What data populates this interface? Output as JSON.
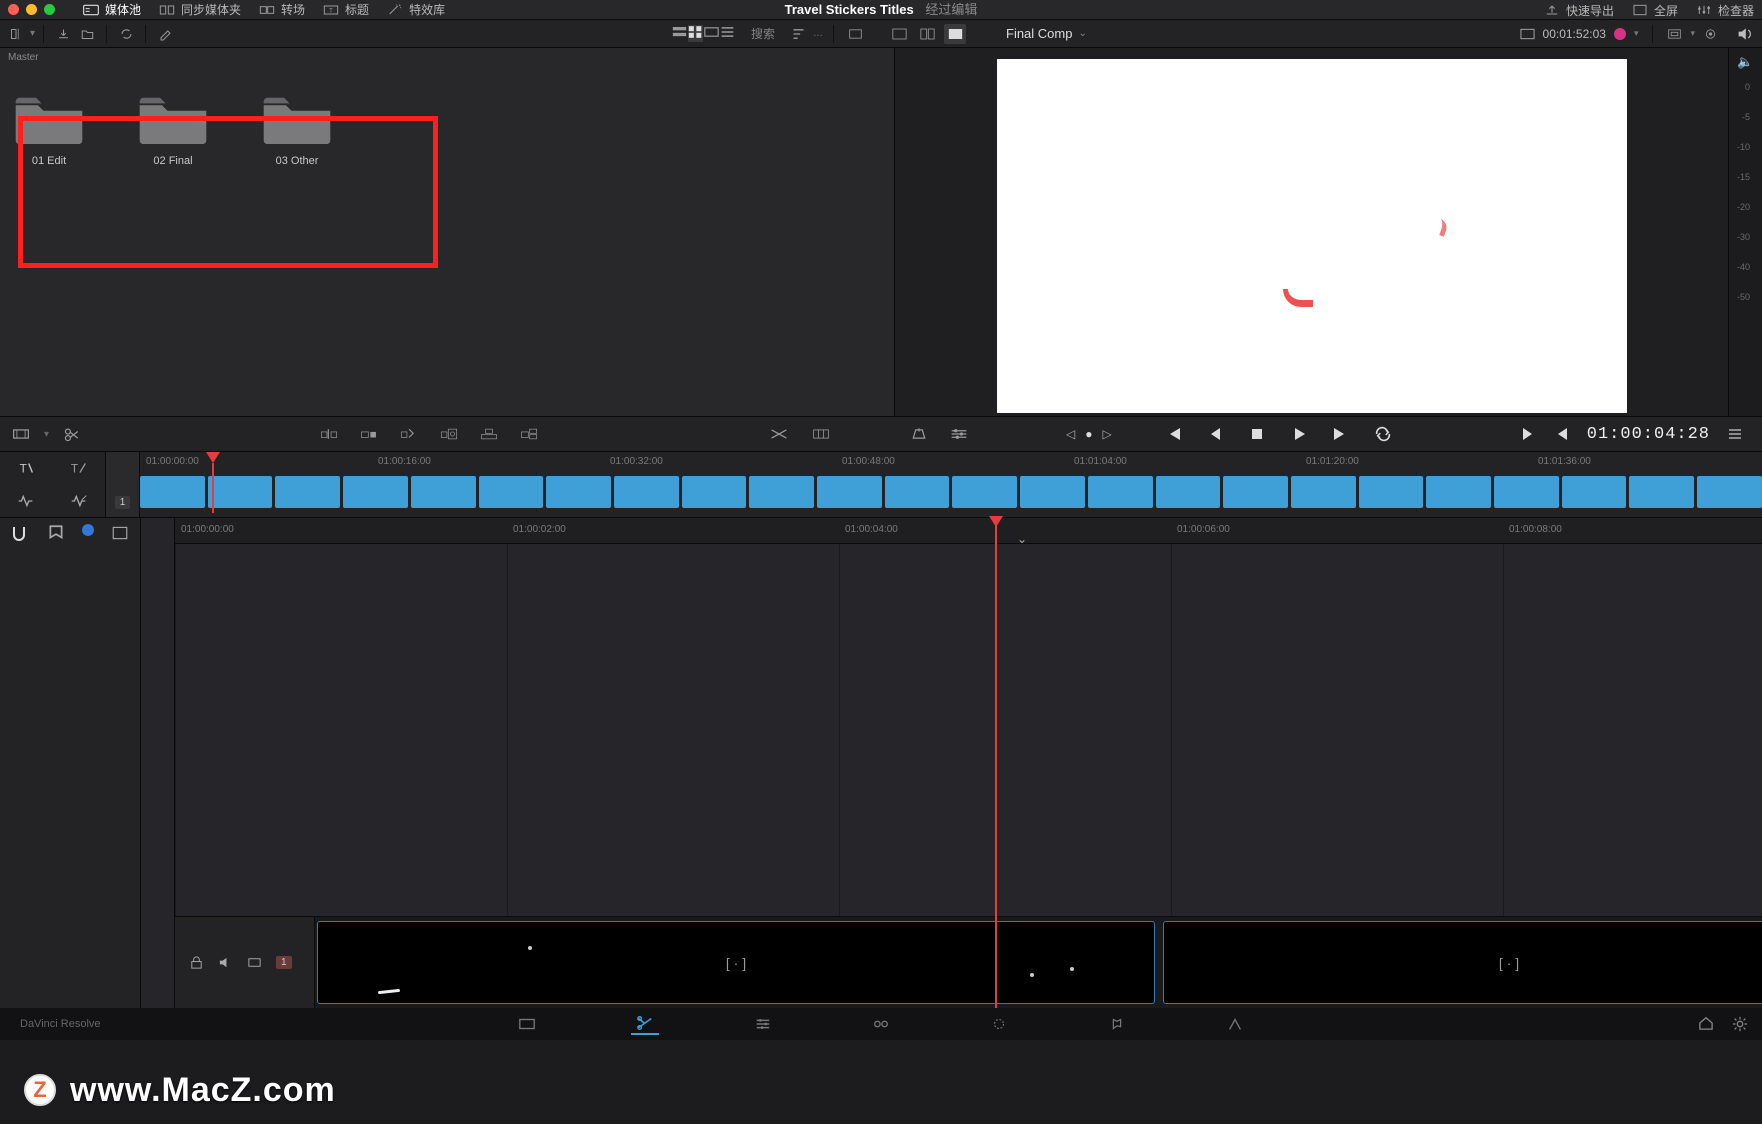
{
  "header": {
    "title": "Travel Stickers Titles",
    "subtitle": "经过编辑",
    "menu": {
      "media_pool": "媒体池",
      "sync_bin": "同步媒体夹",
      "transitions": "转场",
      "titles": "标题",
      "effects": "特效库",
      "quick_export": "快速导出",
      "full_screen": "全屏",
      "inspector": "检查器"
    }
  },
  "subbar": {
    "search_label": "搜索",
    "viewer_title": "Final Comp",
    "source_tc": "00:01:52:03"
  },
  "media_pool": {
    "breadcrumb": "Master",
    "folders": [
      {
        "label": "01 Edit"
      },
      {
        "label": "02 Final"
      },
      {
        "label": "03 Other"
      }
    ]
  },
  "audio_meter": {
    "scale": [
      "0",
      "-5",
      "-10",
      "-15",
      "-20",
      "-30",
      "-40",
      "-50"
    ]
  },
  "transport": {
    "timecode": "01:00:04:28"
  },
  "upper_timeline": {
    "track_label": "1",
    "ruler": [
      "01:00:00:00",
      "01:00:16:00",
      "01:00:32:00",
      "01:00:48:00",
      "01:01:04:00",
      "01:01:20:00",
      "01:01:36:00"
    ],
    "playhead_pct": 4.3,
    "clip_count": 24
  },
  "lower_timeline": {
    "ruler": [
      "01:00:00:00",
      "01:00:02:00",
      "01:00:04:00",
      "01:00:06:00",
      "01:00:08:00"
    ],
    "playhead_pct": 51.2,
    "track_label": "1",
    "clips_in_out": "[ · ]"
  },
  "watermark": {
    "text": "www.MacZ.com",
    "badge": "Z"
  }
}
